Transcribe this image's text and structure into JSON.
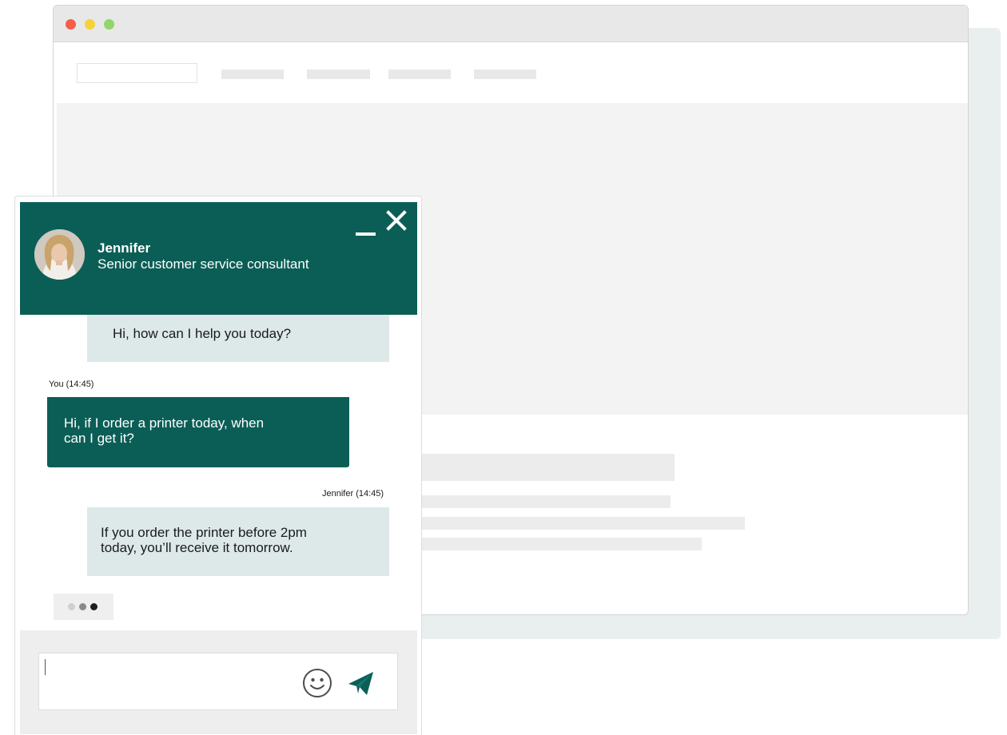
{
  "chat": {
    "agent_name": "Jennifer",
    "agent_role": "Senior customer service consultant",
    "messages": [
      {
        "sender": "agent",
        "text": "Hi, how can I help you today?"
      },
      {
        "sender": "user",
        "meta": "You (14:45)",
        "lines": [
          "Hi, if I order a printer today, when",
          "can I get it?"
        ]
      },
      {
        "sender": "agent",
        "meta": "Jennifer (14:45)",
        "lines": [
          "If you order the printer before 2pm",
          "today, you’ll receive it tomorrow."
        ]
      }
    ],
    "icons": {
      "minimize": "minimize-icon",
      "close": "close-icon",
      "emoji": "smiley-icon",
      "send": "paper-plane-icon"
    }
  },
  "colors": {
    "brand": "#0b5e56",
    "agent_bubble": "#dde9e9",
    "typing_dots": [
      "#cfcfcf",
      "#8a8a8a",
      "#1e1e1e"
    ]
  }
}
